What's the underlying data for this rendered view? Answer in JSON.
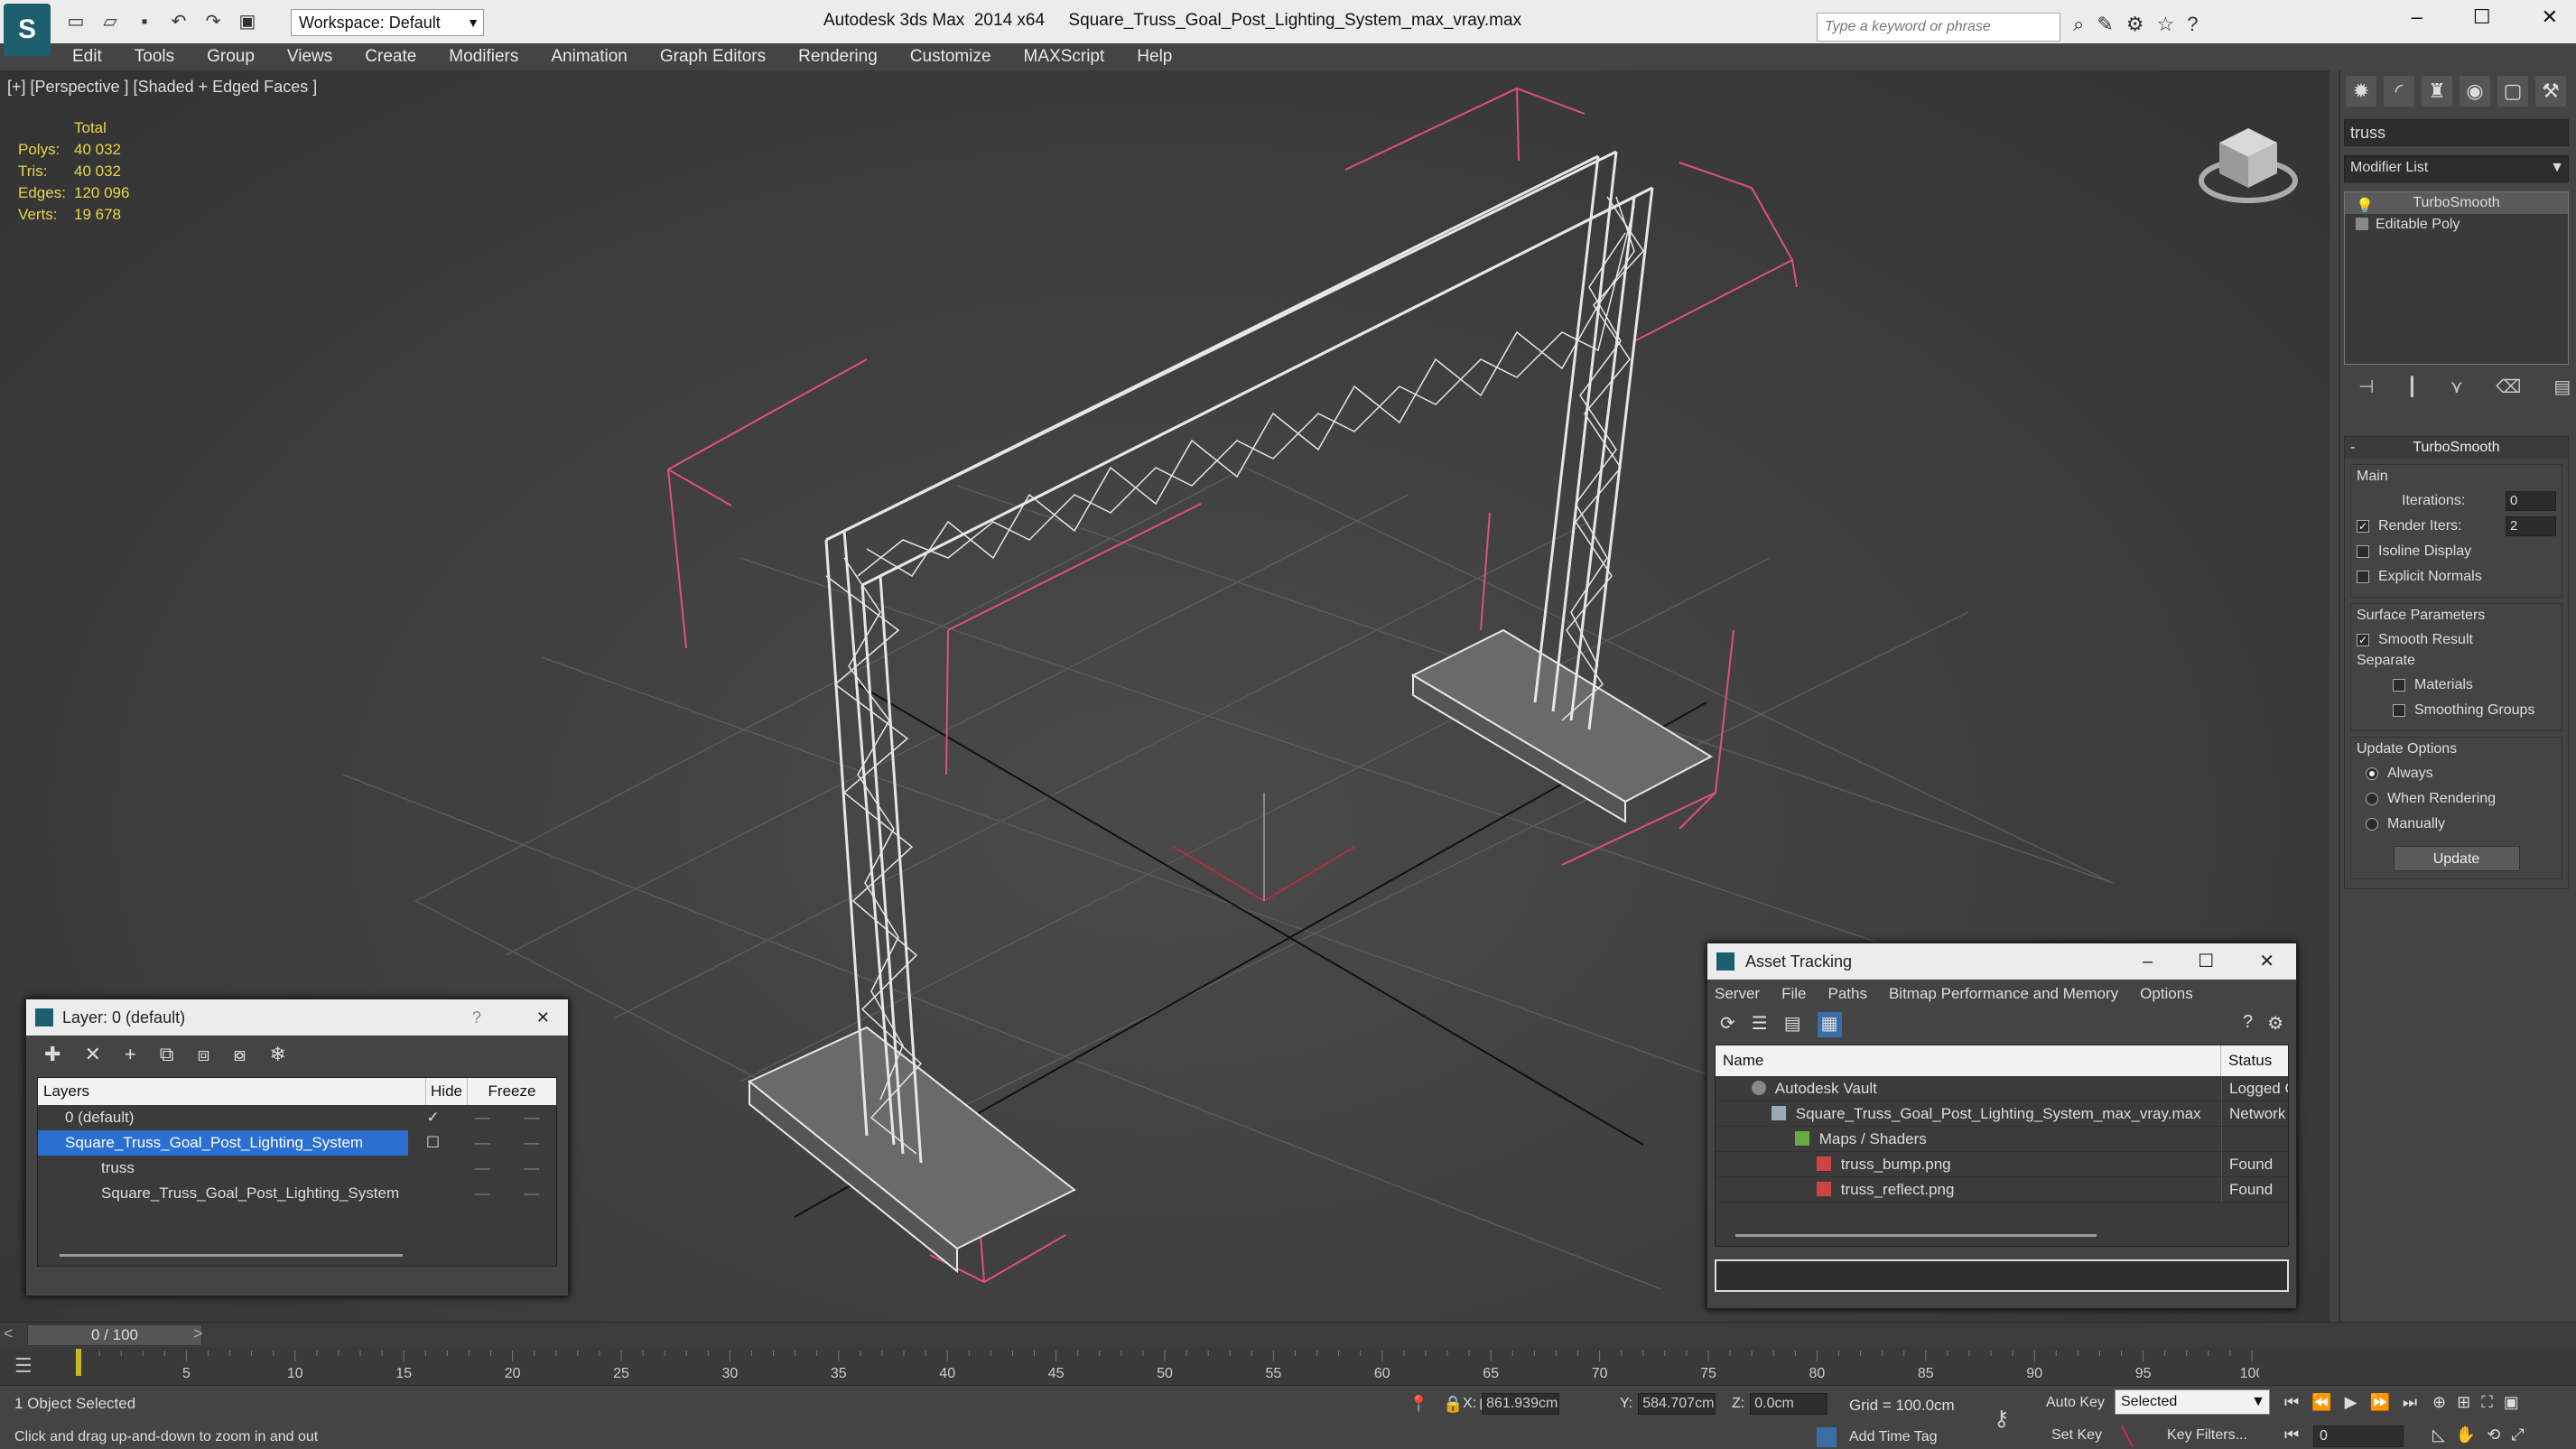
{
  "titlebar": {
    "workspace_label": "Workspace: Default",
    "title": "Autodesk 3ds Max  2014 x64     Square_Truss_Goal_Post_Lighting_System_max_vray.max",
    "search_placeholder": "Type a keyword or phrase"
  },
  "menu": [
    "Edit",
    "Tools",
    "Group",
    "Views",
    "Create",
    "Modifiers",
    "Animation",
    "Graph Editors",
    "Rendering",
    "Customize",
    "MAXScript",
    "Help"
  ],
  "viewport": {
    "label": "[+] [Perspective ] [Shaded + Edged Faces ]",
    "stats": {
      "total_label": "Total",
      "rows": [
        {
          "k": "Polys:",
          "v": "40 032"
        },
        {
          "k": "Tris:",
          "v": "40 032"
        },
        {
          "k": "Edges:",
          "v": "120 096"
        },
        {
          "k": "Verts:",
          "v": "19 678"
        }
      ]
    }
  },
  "command_panel": {
    "object_name": "truss",
    "modifier_list_label": "Modifier List",
    "stack": [
      "TurboSmooth",
      "Editable Poly"
    ],
    "rollout_title": "TurboSmooth",
    "main_label": "Main",
    "iterations_label": "Iterations:",
    "iterations_value": "0",
    "render_iters_label": "Render Iters:",
    "render_iters_value": "2",
    "isoline_label": "Isoline Display",
    "explicit_normals_label": "Explicit Normals",
    "surface_params_label": "Surface Parameters",
    "smooth_result_label": "Smooth Result",
    "separate_label": "Separate",
    "materials_label": "Materials",
    "smoothing_groups_label": "Smoothing Groups",
    "update_options_label": "Update Options",
    "always_label": "Always",
    "when_rendering_label": "When Rendering",
    "manually_label": "Manually",
    "update_button": "Update"
  },
  "layer_window": {
    "title": "Layer: 0 (default)",
    "help": "?",
    "col_layers": "Layers",
    "col_hide": "Hide",
    "col_freeze": "Freeze",
    "rows": [
      {
        "name": "0 (default)"
      },
      {
        "name": "Square_Truss_Goal_Post_Lighting_System"
      },
      {
        "name": "truss"
      },
      {
        "name": "Square_Truss_Goal_Post_Lighting_System"
      }
    ]
  },
  "asset_window": {
    "title": "Asset Tracking",
    "menu": [
      "Server",
      "File",
      "Paths",
      "Bitmap Performance and Memory",
      "Options"
    ],
    "col_name": "Name",
    "col_status": "Status",
    "rows": [
      {
        "name": "Autodesk Vault",
        "status": "Logged O"
      },
      {
        "name": "Square_Truss_Goal_Post_Lighting_System_max_vray.max",
        "status": "Network"
      },
      {
        "name": "Maps / Shaders",
        "status": ""
      },
      {
        "name": "truss_bump.png",
        "status": "Found"
      },
      {
        "name": "truss_reflect.png",
        "status": "Found"
      }
    ]
  },
  "timeline": {
    "frame_label": "0 / 100",
    "ticks": [
      "5",
      "10",
      "15",
      "20",
      "25",
      "30",
      "35",
      "40",
      "45",
      "50",
      "55",
      "60",
      "65",
      "70",
      "75",
      "80",
      "85",
      "90",
      "95",
      "100"
    ]
  },
  "status": {
    "selection": "1 Object Selected",
    "prompt": "Click and drag up-and-down to zoom in and out",
    "x_label": "X:",
    "x_value": "861.939cm",
    "y_label": "Y:",
    "y_value": "584.707cm",
    "z_label": "Z:",
    "z_value": "0.0cm",
    "grid": "Grid = 100.0cm",
    "add_time_tag": "Add Time Tag",
    "auto_key": "Auto Key",
    "set_key": "Set Key",
    "selection_set": "Selected",
    "key_filters": "Key Filters...",
    "current_frame": "0"
  },
  "colors": {
    "stats_yellow": "#e8d44d",
    "selection_blue": "#2b6fd1",
    "bounding_pink": "#e0507a"
  }
}
